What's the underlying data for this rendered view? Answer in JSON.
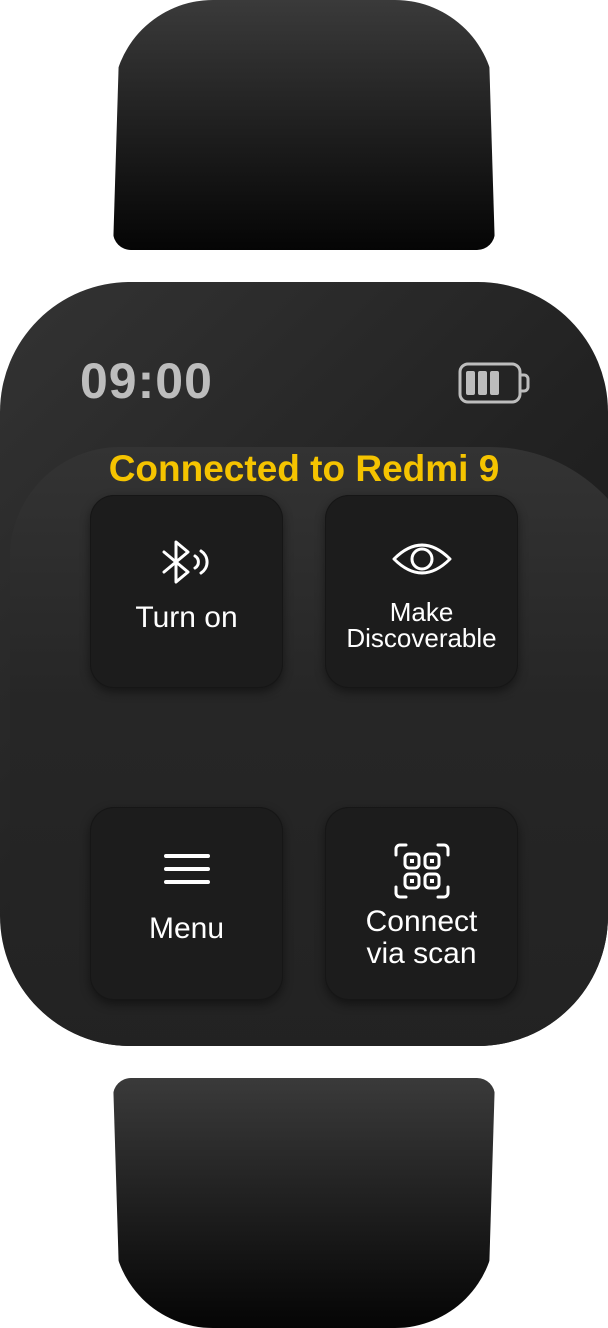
{
  "status_bar": {
    "time": "09:00",
    "battery_icon": "battery-three-quarter-icon",
    "battery_level": 0.75
  },
  "buttons": [
    {
      "label": "Turn on",
      "icon": "bluetooth-icon"
    },
    {
      "label_line1": "Make",
      "label_line2": "Discoverable",
      "icon": "eye-icon"
    },
    {
      "label": "Menu",
      "icon": "hamburger-menu-icon"
    },
    {
      "label_line1": "Connect",
      "label_line2": "via scan",
      "icon": "qr-scan-icon"
    }
  ],
  "status_text": "Connected to Redmi 9",
  "colors": {
    "accent": "#f5c400",
    "text": "#ffffff",
    "time": "#bdbdbd",
    "button_bg": "#1c1c1c"
  }
}
